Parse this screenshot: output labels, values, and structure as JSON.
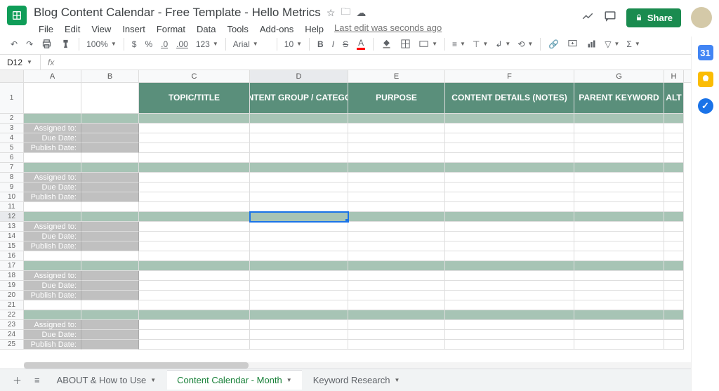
{
  "doc": {
    "title": "Blog Content Calendar - Free Template - Hello Metrics",
    "last_edit": "Last edit was seconds ago"
  },
  "menus": [
    "File",
    "Edit",
    "View",
    "Insert",
    "Format",
    "Data",
    "Tools",
    "Add-ons",
    "Help"
  ],
  "share_label": "Share",
  "toolbar": {
    "zoom": "100%",
    "font": "Arial",
    "size": "10",
    "currency": "$",
    "percent": "%",
    "dec_dec": ".0",
    "inc_dec": ".00",
    "num_fmt": "123"
  },
  "namebox": "D12",
  "fx_label": "fx",
  "columns": [
    "A",
    "B",
    "C",
    "D",
    "E",
    "F",
    "G",
    "H"
  ],
  "col_headers_row1": {
    "c": "TOPIC/TITLE",
    "d": "CONTENT GROUP / CATEGORY",
    "e": "PURPOSE",
    "f": "CONTENT DETAILS (NOTES)",
    "g": "PARENT KEYWORD",
    "h": "ALT"
  },
  "block_labels": {
    "assigned": "Assigned to:",
    "due": "Due Date:",
    "publish": "Publish Date:"
  },
  "tabs": {
    "about": "ABOUT & How to Use",
    "calendar": "Content Calendar - Month",
    "keyword": "Keyword Research"
  }
}
